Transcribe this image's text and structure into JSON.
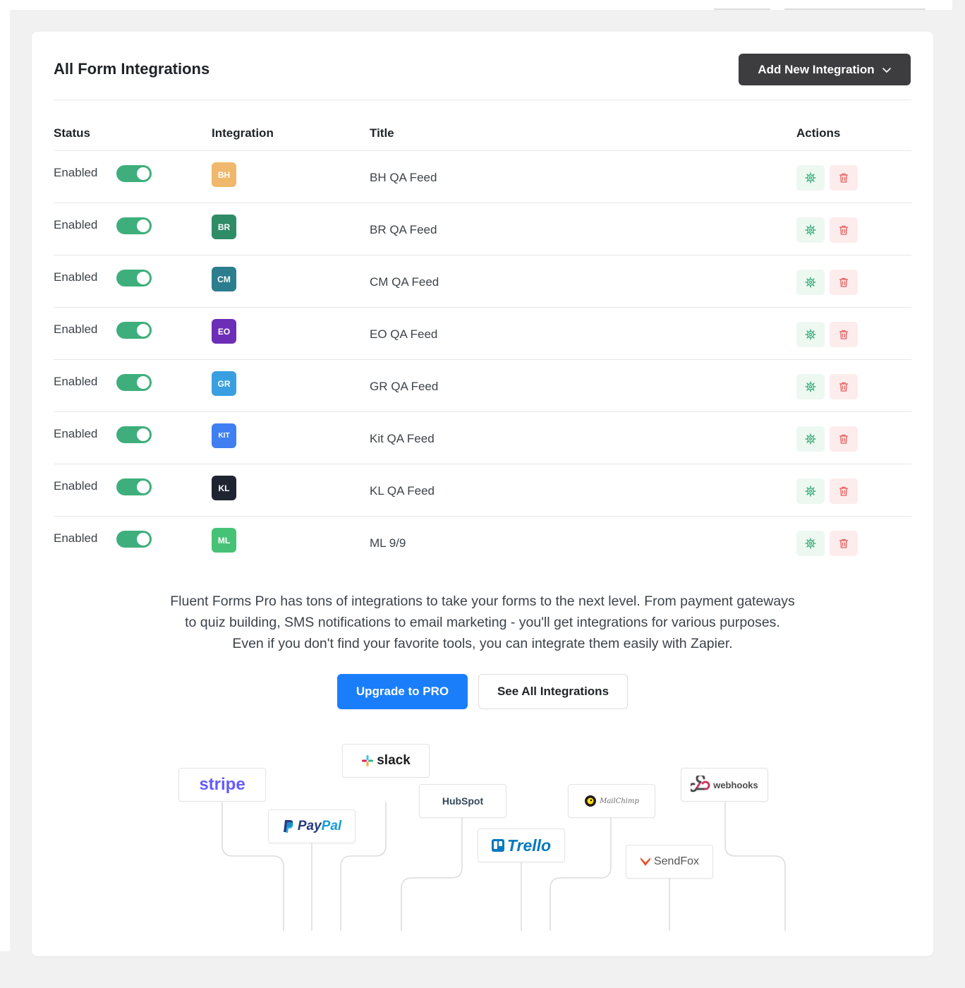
{
  "page": {
    "title": "All Form Integrations",
    "add_button_label": "Add New Integration"
  },
  "table": {
    "headers": {
      "status": "Status",
      "integration": "Integration",
      "title": "Title",
      "actions": "Actions"
    },
    "rows": [
      {
        "status": "Enabled",
        "enabled": true,
        "badge": "BH",
        "badge_color": "#f0b86a",
        "title": "BH QA Feed"
      },
      {
        "status": "Enabled",
        "enabled": true,
        "badge": "BR",
        "badge_color": "#2e8c67",
        "title": "BR QA Feed"
      },
      {
        "status": "Enabled",
        "enabled": true,
        "badge": "CM",
        "badge_color": "#2c7d8e",
        "title": "CM QA Feed"
      },
      {
        "status": "Enabled",
        "enabled": true,
        "badge": "EO",
        "badge_color": "#6c2eb6",
        "title": "EO QA Feed"
      },
      {
        "status": "Enabled",
        "enabled": true,
        "badge": "GR",
        "badge_color": "#3a9fe0",
        "title": "GR QA Feed"
      },
      {
        "status": "Enabled",
        "enabled": true,
        "badge": "KIT",
        "badge_color": "#3f7ff2",
        "title": "Kit QA Feed"
      },
      {
        "status": "Enabled",
        "enabled": true,
        "badge": "KL",
        "badge_color": "#1f2430",
        "title": "KL QA Feed"
      },
      {
        "status": "Enabled",
        "enabled": true,
        "badge": "ML",
        "badge_color": "#46c276",
        "title": "ML 9/9"
      }
    ]
  },
  "promo": {
    "lines": [
      "Fluent Forms Pro has tons of integrations to take your forms to the next level. From payment gateways",
      "to quiz building, SMS notifications to email marketing - you'll get integrations for various purposes.",
      "Even if you don't find your favorite tools, you can integrate them easily with Zapier."
    ],
    "upgrade_label": "Upgrade to PRO",
    "see_all_label": "See All Integrations"
  },
  "logos": {
    "stripe": "stripe",
    "slack": "slack",
    "paypal_pay": "Pay",
    "paypal_pal": "Pal",
    "hubspot": "HubSpot",
    "trello": "Trello",
    "mailchimp": "MailChimp",
    "sendfox": "SendFox",
    "webhooks": "webhooks"
  },
  "colors": {
    "toggle_on": "#3eaf7c",
    "primary": "#1a7efb",
    "dark_button": "#3d3d3f",
    "gear": "#3eaf7c",
    "trash": "#e35d5d",
    "stripe": "#635bff",
    "paypal_dark": "#253b80",
    "paypal_light": "#179bd7",
    "trello": "#0079bf"
  }
}
